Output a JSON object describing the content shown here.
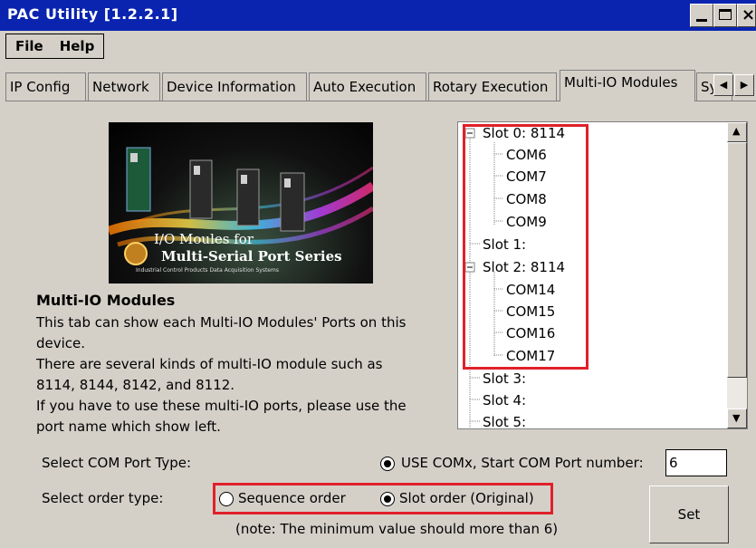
{
  "window": {
    "title": "PAC Utility  [1.2.2.1]"
  },
  "menu": {
    "items": [
      "File",
      "Help"
    ]
  },
  "tabs": [
    "IP Config",
    "Network",
    "Device Information",
    "Auto Execution",
    "Rotary Execution",
    "Multi-IO Modules",
    "Sy"
  ],
  "active_tab": "Multi-IO Modules",
  "banner": {
    "line1": "I/O Moules for",
    "line2": "Multi-Serial Port Series",
    "line3": "Industrial Control Products Data Acquisition Systems"
  },
  "info": {
    "heading": "Multi-IO Modules",
    "lines": [
      "This tab can show each Multi-IO Modules' Ports on this",
      "device.",
      "There are several kinds of multi-IO module such as",
      "8114, 8144, 8142, and 8112.",
      "If you have to use these multi-IO ports, please use the",
      "port name which show left."
    ]
  },
  "tree": {
    "items": [
      "Slot 0: 8114",
      "COM6",
      "COM7",
      "COM8",
      "COM9",
      "Slot 1:",
      "Slot 2: 8114",
      "COM14",
      "COM15",
      "COM16",
      "COM17",
      "Slot 3:",
      "Slot 4:",
      "Slot 5:"
    ]
  },
  "com_type": {
    "label": "Select COM Port Type:",
    "option": "USE COMx, Start COM Port number:",
    "value": "6"
  },
  "order_type": {
    "label": "Select order type:",
    "option_sequence": "Sequence order",
    "option_slot": "Slot order (Original)",
    "selected": "slot"
  },
  "note": "(note: The minimum value should more than 6)",
  "set_button": "Set",
  "colors": {
    "titlebar": "#0a24b0",
    "highlight": "#e0202a",
    "face": "#d4d0c8"
  }
}
